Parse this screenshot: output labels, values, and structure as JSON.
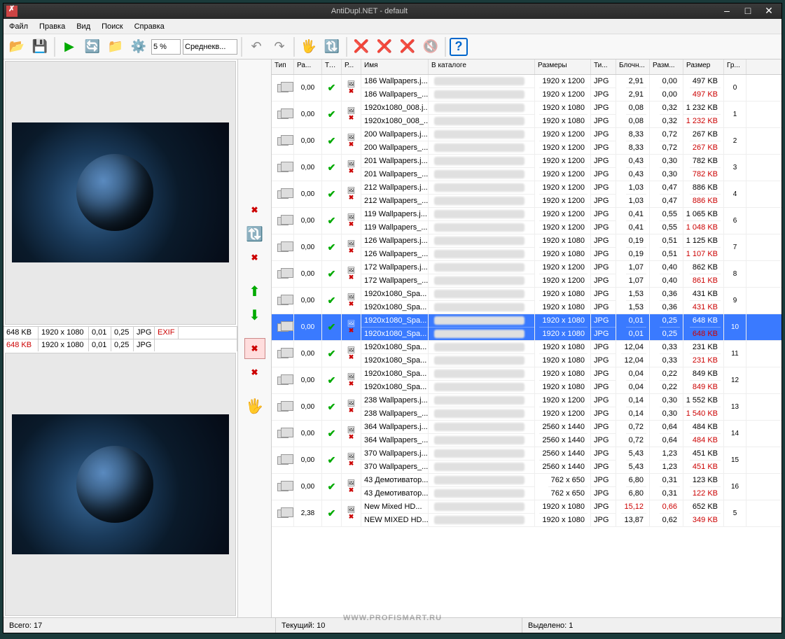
{
  "title": "AntiDupl.NET - default",
  "menu": {
    "file": "Файл",
    "edit": "Правка",
    "view": "Вид",
    "search": "Поиск",
    "help": "Справка"
  },
  "toolbar": {
    "zoom": "5 %",
    "algo": "Среднекв..."
  },
  "columns": {
    "type": "Тип",
    "ra": "Ра...",
    "tr": "Тр...",
    "r": "Р...",
    "name": "Имя",
    "dir": "В каталоге",
    "dim": "Размеры",
    "ti": "Ти...",
    "block": "Блочн...",
    "razm": "Разм...",
    "size": "Размер",
    "gr": "Гр..."
  },
  "preview1": {
    "size": "648 KB",
    "dim": "1920 x 1080",
    "v1": "0,01",
    "v2": "0,25",
    "fmt": "JPG",
    "exif": "EXIF"
  },
  "preview2": {
    "size": "648 KB",
    "dim": "1920 x 1080",
    "v1": "0,01",
    "v2": "0,25",
    "fmt": "JPG"
  },
  "status": {
    "total_label": "Всего:",
    "total": "17",
    "current_label": "Текущий:",
    "current": "10",
    "selected_label": "Выделено:",
    "selected": "1"
  },
  "watermark": "WWW.PROFISMART.RU",
  "rows": [
    {
      "ra": "0,00",
      "n1": "186 Wallpapers.j...",
      "n2": "186 Wallpapers_...",
      "d1": "1920 x 1200",
      "d2": "1920 x 1200",
      "t": "JPG",
      "b1": "2,91",
      "b2": "2,91",
      "r1": "0,00",
      "r2": "0,00",
      "s1": "497 KB",
      "s2": "497 KB",
      "s2red": true,
      "gr": "0"
    },
    {
      "ra": "0,00",
      "n1": "1920x1080_008.j...",
      "n2": "1920x1080_008_...",
      "d1": "1920 x 1080",
      "d2": "1920 x 1080",
      "t": "JPG",
      "b1": "0,08",
      "b2": "0,08",
      "r1": "0,32",
      "r2": "0,32",
      "s1": "1 232 KB",
      "s2": "1 232 KB",
      "s2red": true,
      "gr": "1"
    },
    {
      "ra": "0,00",
      "n1": "200 Wallpapers.j...",
      "n2": "200 Wallpapers_...",
      "d1": "1920 x 1200",
      "d2": "1920 x 1200",
      "t": "JPG",
      "b1": "8,33",
      "b2": "8,33",
      "r1": "0,72",
      "r2": "0,72",
      "s1": "267 KB",
      "s2": "267 KB",
      "s2red": true,
      "gr": "2"
    },
    {
      "ra": "0,00",
      "n1": "201 Wallpapers.j...",
      "n2": "201 Wallpapers_...",
      "d1": "1920 x 1200",
      "d2": "1920 x 1200",
      "t": "JPG",
      "b1": "0,43",
      "b2": "0,43",
      "r1": "0,30",
      "r2": "0,30",
      "s1": "782 KB",
      "s2": "782 KB",
      "s2red": true,
      "gr": "3"
    },
    {
      "ra": "0,00",
      "n1": "212 Wallpapers.j...",
      "n2": "212 Wallpapers_...",
      "d1": "1920 x 1200",
      "d2": "1920 x 1200",
      "t": "JPG",
      "b1": "1,03",
      "b2": "1,03",
      "r1": "0,47",
      "r2": "0,47",
      "s1": "886 KB",
      "s2": "886 KB",
      "s2red": true,
      "gr": "4"
    },
    {
      "ra": "0,00",
      "n1": "119 Wallpapers.j...",
      "n2": "119 Wallpapers_...",
      "d1": "1920 x 1200",
      "d2": "1920 x 1200",
      "t": "JPG",
      "b1": "0,41",
      "b2": "0,41",
      "r1": "0,55",
      "r2": "0,55",
      "s1": "1 065 KB",
      "s2": "1 048 KB",
      "s2red": true,
      "gr": "6"
    },
    {
      "ra": "0,00",
      "n1": "126 Wallpapers.j...",
      "n2": "126 Wallpapers_...",
      "d1": "1920 x 1080",
      "d2": "1920 x 1080",
      "t": "JPG",
      "b1": "0,19",
      "b2": "0,19",
      "r1": "0,51",
      "r2": "0,51",
      "s1": "1 125 KB",
      "s2": "1 107 KB",
      "s2red": true,
      "gr": "7"
    },
    {
      "ra": "0,00",
      "n1": "172 Wallpapers.j...",
      "n2": "172 Wallpapers_...",
      "d1": "1920 x 1200",
      "d2": "1920 x 1200",
      "t": "JPG",
      "b1": "1,07",
      "b2": "1,07",
      "r1": "0,40",
      "r2": "0,40",
      "s1": "862 KB",
      "s2": "861 KB",
      "s2red": true,
      "gr": "8"
    },
    {
      "ra": "0,00",
      "n1": "1920x1080_Spa...",
      "n2": "1920x1080_Spa...",
      "d1": "1920 x 1080",
      "d2": "1920 x 1080",
      "t": "JPG",
      "b1": "1,53",
      "b2": "1,53",
      "r1": "0,36",
      "r2": "0,36",
      "s1": "431 KB",
      "s2": "431 KB",
      "s2red": true,
      "gr": "9"
    },
    {
      "ra": "0,00",
      "n1": "1920x1080_Spa...",
      "n2": "1920x1080_Spa...",
      "d1": "1920 x 1080",
      "d2": "1920 x 1080",
      "t": "JPG",
      "b1": "0,01",
      "b2": "0,01",
      "r1": "0,25",
      "r2": "0,25",
      "s1": "648 KB",
      "s2": "648 KB",
      "s2red": true,
      "gr": "10",
      "selected": true
    },
    {
      "ra": "0,00",
      "n1": "1920x1080_Spa...",
      "n2": "1920x1080_Spa...",
      "d1": "1920 x 1080",
      "d2": "1920 x 1080",
      "t": "JPG",
      "b1": "12,04",
      "b2": "12,04",
      "r1": "0,33",
      "r2": "0,33",
      "s1": "231 KB",
      "s2": "231 KB",
      "s2red": true,
      "gr": "11"
    },
    {
      "ra": "0,00",
      "n1": "1920x1080_Spa...",
      "n2": "1920x1080_Spa...",
      "d1": "1920 x 1080",
      "d2": "1920 x 1080",
      "t": "JPG",
      "b1": "0,04",
      "b2": "0,04",
      "r1": "0,22",
      "r2": "0,22",
      "s1": "849 KB",
      "s2": "849 KB",
      "s2red": true,
      "gr": "12"
    },
    {
      "ra": "0,00",
      "n1": "238 Wallpapers.j...",
      "n2": "238 Wallpapers_...",
      "d1": "1920 x 1200",
      "d2": "1920 x 1200",
      "t": "JPG",
      "b1": "0,14",
      "b2": "0,14",
      "r1": "0,30",
      "r2": "0,30",
      "s1": "1 552 KB",
      "s2": "1 540 KB",
      "s2red": true,
      "gr": "13"
    },
    {
      "ra": "0,00",
      "n1": "364 Wallpapers.j...",
      "n2": "364 Wallpapers_...",
      "d1": "2560 x 1440",
      "d2": "2560 x 1440",
      "t": "JPG",
      "b1": "0,72",
      "b2": "0,72",
      "r1": "0,64",
      "r2": "0,64",
      "s1": "484 KB",
      "s2": "484 KB",
      "s2red": true,
      "gr": "14"
    },
    {
      "ra": "0,00",
      "n1": "370 Wallpapers.j...",
      "n2": "370 Wallpapers_...",
      "d1": "2560 x 1440",
      "d2": "2560 x 1440",
      "t": "JPG",
      "b1": "5,43",
      "b2": "5,43",
      "r1": "1,23",
      "r2": "1,23",
      "s1": "451 KB",
      "s2": "451 KB",
      "s2red": true,
      "gr": "15"
    },
    {
      "ra": "0,00",
      "n1": "43 Демотиватор...",
      "n2": "43 Демотиватор...",
      "d1": "762 x 650",
      "d2": "762 x 650",
      "t": "JPG",
      "b1": "6,80",
      "b2": "6,80",
      "r1": "0,31",
      "r2": "0,31",
      "s1": "123 KB",
      "s2": "122 KB",
      "s2red": true,
      "gr": "16"
    },
    {
      "ra": "2,38",
      "n1": "New Mixed HD...",
      "n2": "NEW MIXED HD...",
      "d1": "1920 x 1080",
      "d2": "1920 x 1080",
      "t": "JPG",
      "b1": "15,12",
      "b1red": true,
      "b2": "13,87",
      "r1": "0,66",
      "r1red": true,
      "r2": "0,62",
      "s1": "652 KB",
      "s2": "349 KB",
      "s2red": true,
      "gr": "5"
    }
  ]
}
